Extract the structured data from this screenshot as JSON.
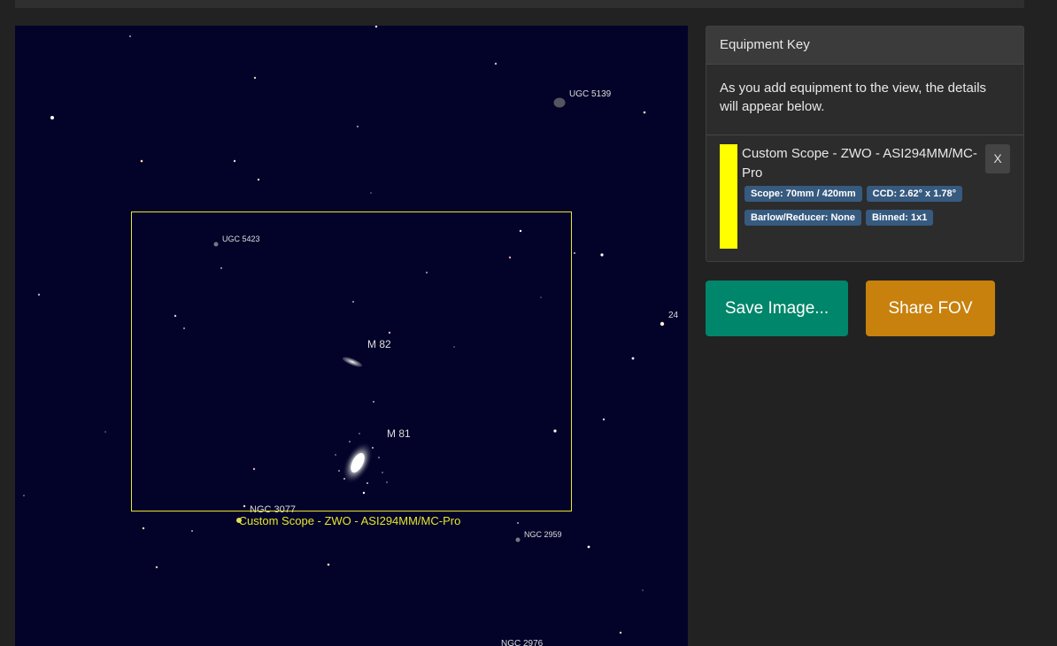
{
  "sky_chart": {
    "objects": [
      {
        "name": "m82",
        "label": "M 82"
      },
      {
        "name": "m81",
        "label": "M 81"
      },
      {
        "name": "ugc-5139",
        "label": "UGC 5139"
      },
      {
        "name": "ugc-5423",
        "label": "UGC 5423"
      },
      {
        "name": "ngc-3077",
        "label": "NGC 3077"
      },
      {
        "name": "ngc-2959",
        "label": "NGC 2959"
      },
      {
        "name": "ngc-2976",
        "label": "NGC 2976"
      },
      {
        "name": "star-24",
        "label": "24"
      }
    ],
    "fov_caption": "Custom Scope - ZWO - ASI294MM/MC-Pro",
    "fov_color": "#e6e62a",
    "background_color": "#03032a"
  },
  "equipment_panel": {
    "title": "Equipment Key",
    "intro": "As you add equipment to the view, the details will appear below.",
    "items": [
      {
        "name": "Custom Scope - ZWO - ASI294MM/MC-Pro",
        "color": "#ffff00",
        "close_label": "X",
        "badges": [
          "Scope: 70mm / 420mm",
          "CCD: 2.62° x 1.78°",
          "Barlow/Reducer: None",
          "Binned: 1x1"
        ]
      }
    ]
  },
  "actions": {
    "save_label": "Save Image...",
    "share_label": "Share FOV",
    "save_color": "#00866a",
    "share_color": "#c7810c"
  }
}
